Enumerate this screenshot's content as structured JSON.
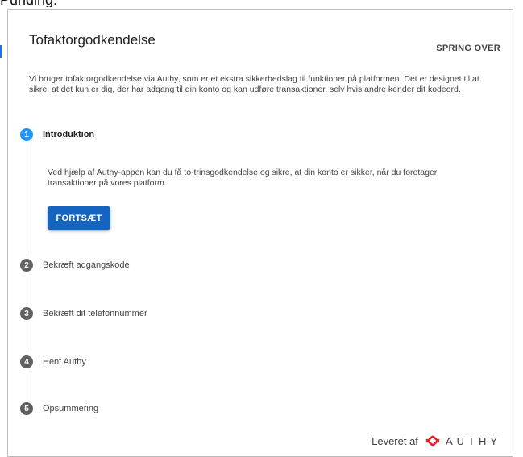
{
  "page_header": "Punding:",
  "dialog": {
    "title": "Tofaktorgodkendelse",
    "skip_label": "SPRING OVER",
    "intro_text": "Vi bruger tofaktorgodkendelse via Authy, som er et ekstra sikkerhedslag til funktioner på platformen. Det er designet til at sikre, at det kun er dig, der har adgang til din konto og kan udføre transaktioner, selv hvis andre kender dit kodeord.",
    "steps": [
      {
        "number": "1",
        "label": "Introduktion",
        "active": true
      },
      {
        "number": "2",
        "label": "Bekræft adgangskode",
        "active": false
      },
      {
        "number": "3",
        "label": "Bekræft dit telefonnummer",
        "active": false
      },
      {
        "number": "4",
        "label": "Hent Authy",
        "active": false
      },
      {
        "number": "5",
        "label": "Opsummering",
        "active": false
      }
    ],
    "step1_description": "Ved hjælp af Authy-appen kan du få to-trinsgodkendelse og sikre, at din konto er sikker, når du foretager transaktioner på vores platform.",
    "continue_label": "FORTSÆT",
    "footer": {
      "provided_by": "Leveret af",
      "brand": "AUTHY",
      "brand_icon": "authy-logo-icon",
      "brand_color": "#ec1c24"
    }
  },
  "colors": {
    "primary_button": "#1565c0",
    "active_step": "#2196f3",
    "inactive_step": "#616161"
  }
}
